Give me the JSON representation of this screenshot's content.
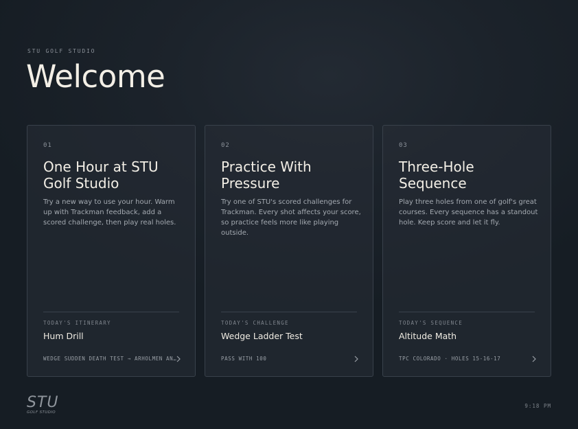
{
  "header": {
    "eyebrow": "STU GOLF STUDIO",
    "title": "Welcome"
  },
  "cards": [
    {
      "number": "01",
      "title": "One Hour at STU Golf Studio",
      "description": "Try a new way to use your hour. Warm up with Trackman feedback, add a scored challenge, then play real holes.",
      "label": "TODAY'S ITINERARY",
      "value": "Hum Drill",
      "footer": "WEDGE SUDDEN DEATH TEST → ARHOLMEN AND TH…",
      "chevron_icon": "chevron-right-icon"
    },
    {
      "number": "02",
      "title": "Practice With Pressure",
      "description": "Try one of STU's scored challenges for Trackman. Every shot affects your score, so practice feels more like playing outside.",
      "label": "TODAY'S CHALLENGE",
      "value": "Wedge Ladder Test",
      "footer": "PASS WITH 100",
      "chevron_icon": "chevron-right-icon"
    },
    {
      "number": "03",
      "title": "Three-Hole Sequence",
      "description": "Play three holes from one of golf's great courses. Every sequence has a standout hole. Keep score and let it fly.",
      "label": "TODAY'S SEQUENCE",
      "value": "Altitude Math",
      "footer": "TPC COLORADO · HOLES 15-16-17",
      "chevron_icon": "chevron-right-icon"
    }
  ],
  "footer": {
    "logo_text": "STU",
    "logo_subtext": "GOLF STUDIO",
    "clock": "9:18 PM"
  },
  "colors": {
    "background": "#1c232b",
    "card_border": "#39414b",
    "text_primary": "#f3efe6",
    "text_muted": "#8b9199"
  }
}
